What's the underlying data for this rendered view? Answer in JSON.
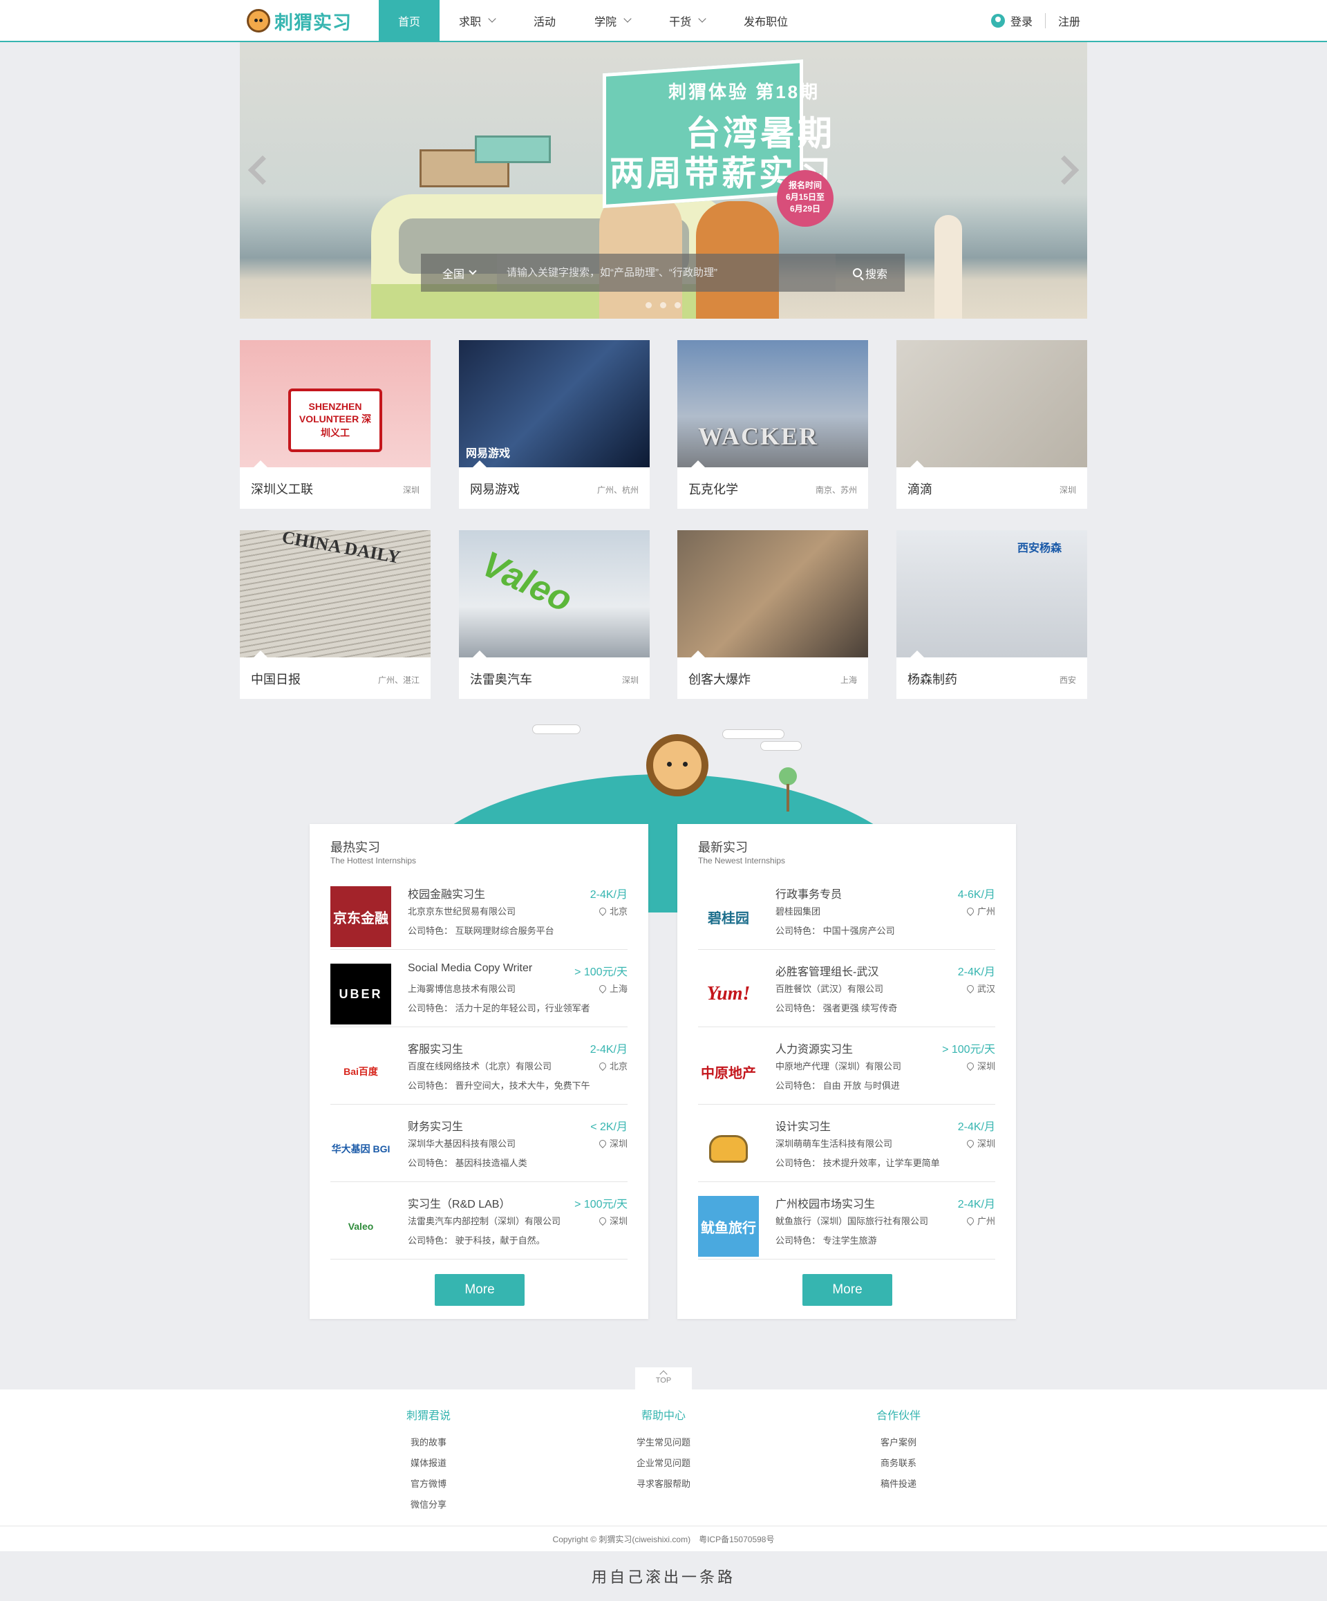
{
  "header": {
    "logo_text": "刺猬实习",
    "nav": [
      {
        "label": "首页",
        "active": true,
        "has_dropdown": false
      },
      {
        "label": "求职",
        "active": false,
        "has_dropdown": true
      },
      {
        "label": "活动",
        "active": false,
        "has_dropdown": false
      },
      {
        "label": "学院",
        "active": false,
        "has_dropdown": true
      },
      {
        "label": "干货",
        "active": false,
        "has_dropdown": true
      },
      {
        "label": "发布职位",
        "active": false,
        "has_dropdown": false
      }
    ],
    "login": "登录",
    "register": "注册"
  },
  "banner": {
    "subtitle": "刺猬体验 第18期",
    "line1": "台湾暑期",
    "line2": "两周带薪实习",
    "badge": [
      "报名时间",
      "6月15日至",
      "6月29日"
    ],
    "search": {
      "scope": "全国",
      "placeholder": "请输入关键字搜索，如“产品助理”、“行政助理”",
      "button": "搜索"
    }
  },
  "companies": [
    {
      "name": "深圳义工联",
      "city": "深圳",
      "img_text": "SHENZHEN VOLUNTEER 深圳义工"
    },
    {
      "name": "网易游戏",
      "city": "广州、杭州",
      "img_text": "网易游戏"
    },
    {
      "name": "瓦克化学",
      "city": "南京、苏州",
      "img_text": "WACKER"
    },
    {
      "name": "滴滴",
      "city": "深圳",
      "img_text": ""
    },
    {
      "name": "中国日报",
      "city": "广州、湛江",
      "img_text": "CHINA DAILY"
    },
    {
      "name": "法雷奥汽车",
      "city": "深圳",
      "img_text": "Valeo"
    },
    {
      "name": "创客大爆炸",
      "city": "上海",
      "img_text": ""
    },
    {
      "name": "杨森制药",
      "city": "西安",
      "img_text": "西安杨森"
    }
  ],
  "hottest": {
    "title": "最热实习",
    "subtitle": "The Hottest Internships",
    "more": "More",
    "jobs": [
      {
        "title": "校园金融实习生",
        "salary": "2-4K/月",
        "company": "北京京东世纪贸易有限公司",
        "city": "北京",
        "feature": "公司特色： 互联网理财综合服务平台",
        "logo": "京东金融",
        "logo_bg": "#a3232a",
        "logo_color": "#ffffff"
      },
      {
        "title": "Social Media Copy Writer",
        "salary": "> 100元/天",
        "company": "上海雾博信息技术有限公司",
        "city": "上海",
        "feature": "公司特色： 活力十足的年轻公司，行业领军者",
        "logo": "UBER",
        "logo_bg": "#000000",
        "logo_color": "#ffffff"
      },
      {
        "title": "客服实习生",
        "salary": "2-4K/月",
        "company": "百度在线网络技术（北京）有限公司",
        "city": "北京",
        "feature": "公司特色： 晋升空间大，技术大牛，免费下午",
        "logo": "Bai百度",
        "logo_bg": "#ffffff",
        "logo_color": "#d7261d"
      },
      {
        "title": "财务实习生",
        "salary": "< 2K/月",
        "company": "深圳华大基因科技有限公司",
        "city": "深圳",
        "feature": "公司特色： 基因科技造福人类",
        "logo": "华大基因 BGI",
        "logo_bg": "#ffffff",
        "logo_color": "#1a5aa8"
      },
      {
        "title": "实习生（R&D LAB）",
        "salary": "> 100元/天",
        "company": "法雷奥汽车内部控制（深圳）有限公司",
        "city": "深圳",
        "feature": "公司特色： 驶于科技，献于自然。",
        "logo": "Valeo",
        "logo_bg": "#ffffff",
        "logo_color": "#2e8b3a"
      }
    ]
  },
  "newest": {
    "title": "最新实习",
    "subtitle": "The Newest Internships",
    "more": "More",
    "jobs": [
      {
        "title": "行政事务专员",
        "salary": "4-6K/月",
        "company": "碧桂园集团",
        "city": "广州",
        "feature": "公司特色： 中国十强房产公司",
        "logo": "碧桂园",
        "logo_bg": "#ffffff",
        "logo_color": "#1c6e8c"
      },
      {
        "title": "必胜客管理组长-武汉",
        "salary": "2-4K/月",
        "company": "百胜餐饮（武汉）有限公司",
        "city": "武汉",
        "feature": "公司特色： 强者更强 续写传奇",
        "logo": "Yum!",
        "logo_bg": "#ffffff",
        "logo_color": "#c4161c"
      },
      {
        "title": "人力资源实习生",
        "salary": "> 100元/天",
        "company": "中原地产代理（深圳）有限公司",
        "city": "深圳",
        "feature": "公司特色： 自由 开放 与时俱进",
        "logo": "中原地产",
        "logo_bg": "#ffffff",
        "logo_color": "#c4161c"
      },
      {
        "title": "设计实习生",
        "salary": "2-4K/月",
        "company": "深圳萌萌车生活科技有限公司",
        "city": "深圳",
        "feature": "公司特色： 技术提升效率，让学车更简单",
        "logo": "",
        "logo_bg": "#ffffff",
        "logo_color": "#f0b43c"
      },
      {
        "title": "广州校园市场实习生",
        "salary": "2-4K/月",
        "company": "鱿鱼旅行（深圳）国际旅行社有限公司",
        "city": "广州",
        "feature": "公司特色： 专注学生旅游",
        "logo": "鱿鱼旅行",
        "logo_bg": "#4aa9df",
        "logo_color": "#ffffff"
      }
    ]
  },
  "footer": {
    "top_label": "TOP",
    "columns": [
      {
        "title": "刺猬君说",
        "links": [
          "我的故事",
          "媒体报道",
          "官方微博",
          "微信分享"
        ]
      },
      {
        "title": "帮助中心",
        "links": [
          "学生常见问题",
          "企业常见问题",
          "寻求客服帮助"
        ]
      },
      {
        "title": "合作伙伴",
        "links": [
          "客户案例",
          "商务联系",
          "稿件投递"
        ]
      }
    ],
    "copyright": "Copyright © 刺猬实习(ciweishixi.com)　粤ICP备15070598号",
    "slogan": "用自己滚出一条路"
  },
  "colors": {
    "accent": "#36b5b0",
    "background": "#ecedf0"
  }
}
